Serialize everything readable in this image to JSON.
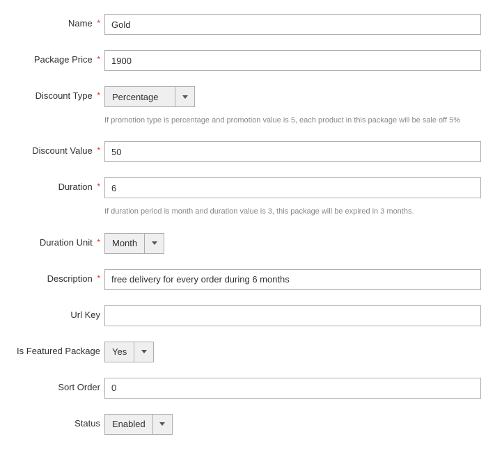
{
  "labels": {
    "name": "Name",
    "package_price": "Package Price",
    "discount_type": "Discount Type",
    "discount_value": "Discount Value",
    "duration": "Duration",
    "duration_unit": "Duration Unit",
    "description": "Description",
    "url_key": "Url Key",
    "is_featured": "Is Featured Package",
    "sort_order": "Sort Order",
    "status": "Status"
  },
  "values": {
    "name": "Gold",
    "package_price": "1900",
    "discount_type": "Percentage",
    "discount_value": "50",
    "duration": "6",
    "duration_unit": "Month",
    "description": "free delivery for every order during 6 months",
    "url_key": "",
    "is_featured": "Yes",
    "sort_order": "0",
    "status": "Enabled"
  },
  "hints": {
    "discount_type": "If promotion type is percentage and promotion value is 5, each product in this package will be sale off 5%",
    "duration": "If duration period is month and duration value is 3, this package will be expired in 3 months."
  },
  "required_marker": "*"
}
